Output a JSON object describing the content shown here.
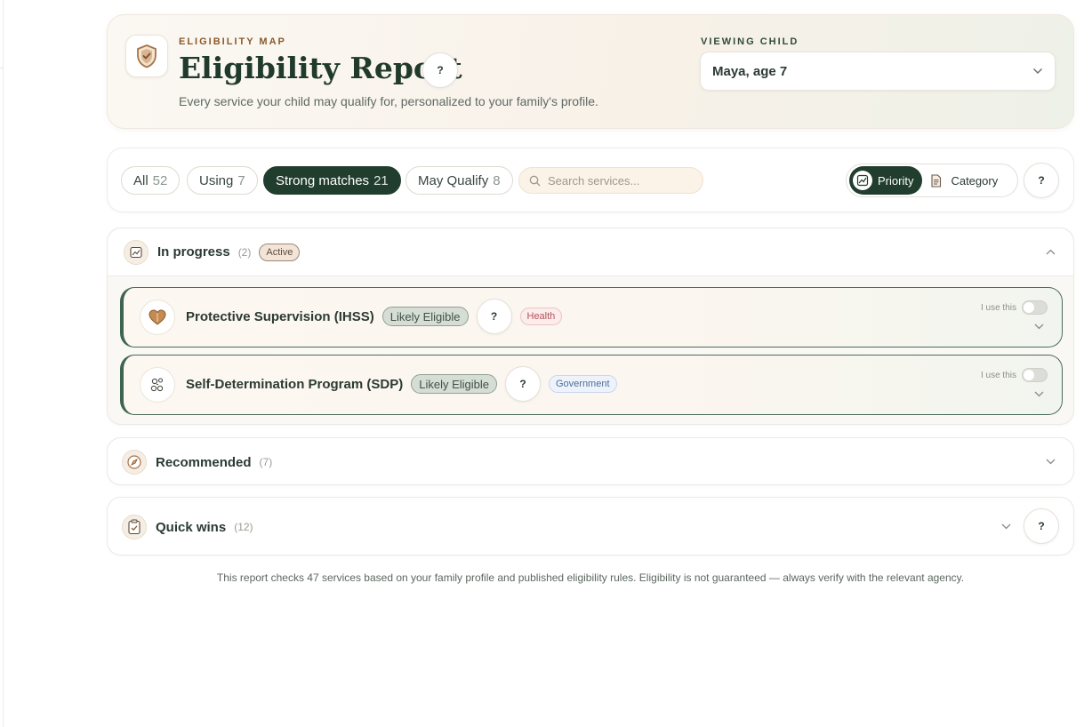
{
  "header": {
    "eyebrow": "ELIGIBILITY MAP",
    "title": "Eligibility Report",
    "help": "?",
    "subtitle": "Every service your child may qualify for, personalized to your family's profile.",
    "viewing_label": "VIEWING CHILD",
    "child_selected": "Maya, age 7"
  },
  "filters": {
    "pills": [
      {
        "label": "All",
        "count": "52"
      },
      {
        "label": "Using",
        "count": "7"
      },
      {
        "label": "Strong matches",
        "count": "21"
      },
      {
        "label": "May Qualify",
        "count": "8"
      }
    ],
    "search_placeholder": "Search services...",
    "sort": {
      "priority": "Priority",
      "category": "Category"
    },
    "help": "?"
  },
  "sections": {
    "in_progress": {
      "title": "In progress",
      "count": "(2)",
      "badge": "Active",
      "items": [
        {
          "name": "Protective Supervision (IHSS)",
          "status": "Likely Eligible",
          "help": "?",
          "tag": "Health",
          "use_label": "I use this"
        },
        {
          "name": "Self-Determination Program (SDP)",
          "status": "Likely Eligible",
          "help": "?",
          "tag": "Government",
          "use_label": "I use this"
        }
      ]
    },
    "recommended": {
      "title": "Recommended",
      "count": "(7)"
    },
    "quick_wins": {
      "title": "Quick wins",
      "count": "(12)",
      "help": "?"
    }
  },
  "footer": {
    "note": "This report checks 47 services based on your family profile and published eligibility rules. Eligibility is not guaranteed — always verify with the relevant agency."
  },
  "colors": {
    "primary": "#213d2e",
    "accent": "#8a5a2b",
    "health": "#b0545c",
    "government": "#4e6e99"
  },
  "icons": {
    "header": "shield-check-icon",
    "in_progress": "chart-icon",
    "recommended": "compass-icon",
    "quick_wins": "clipboard-check-icon",
    "svc_ihss": "heart-icon",
    "svc_sdp": "people-icon"
  }
}
